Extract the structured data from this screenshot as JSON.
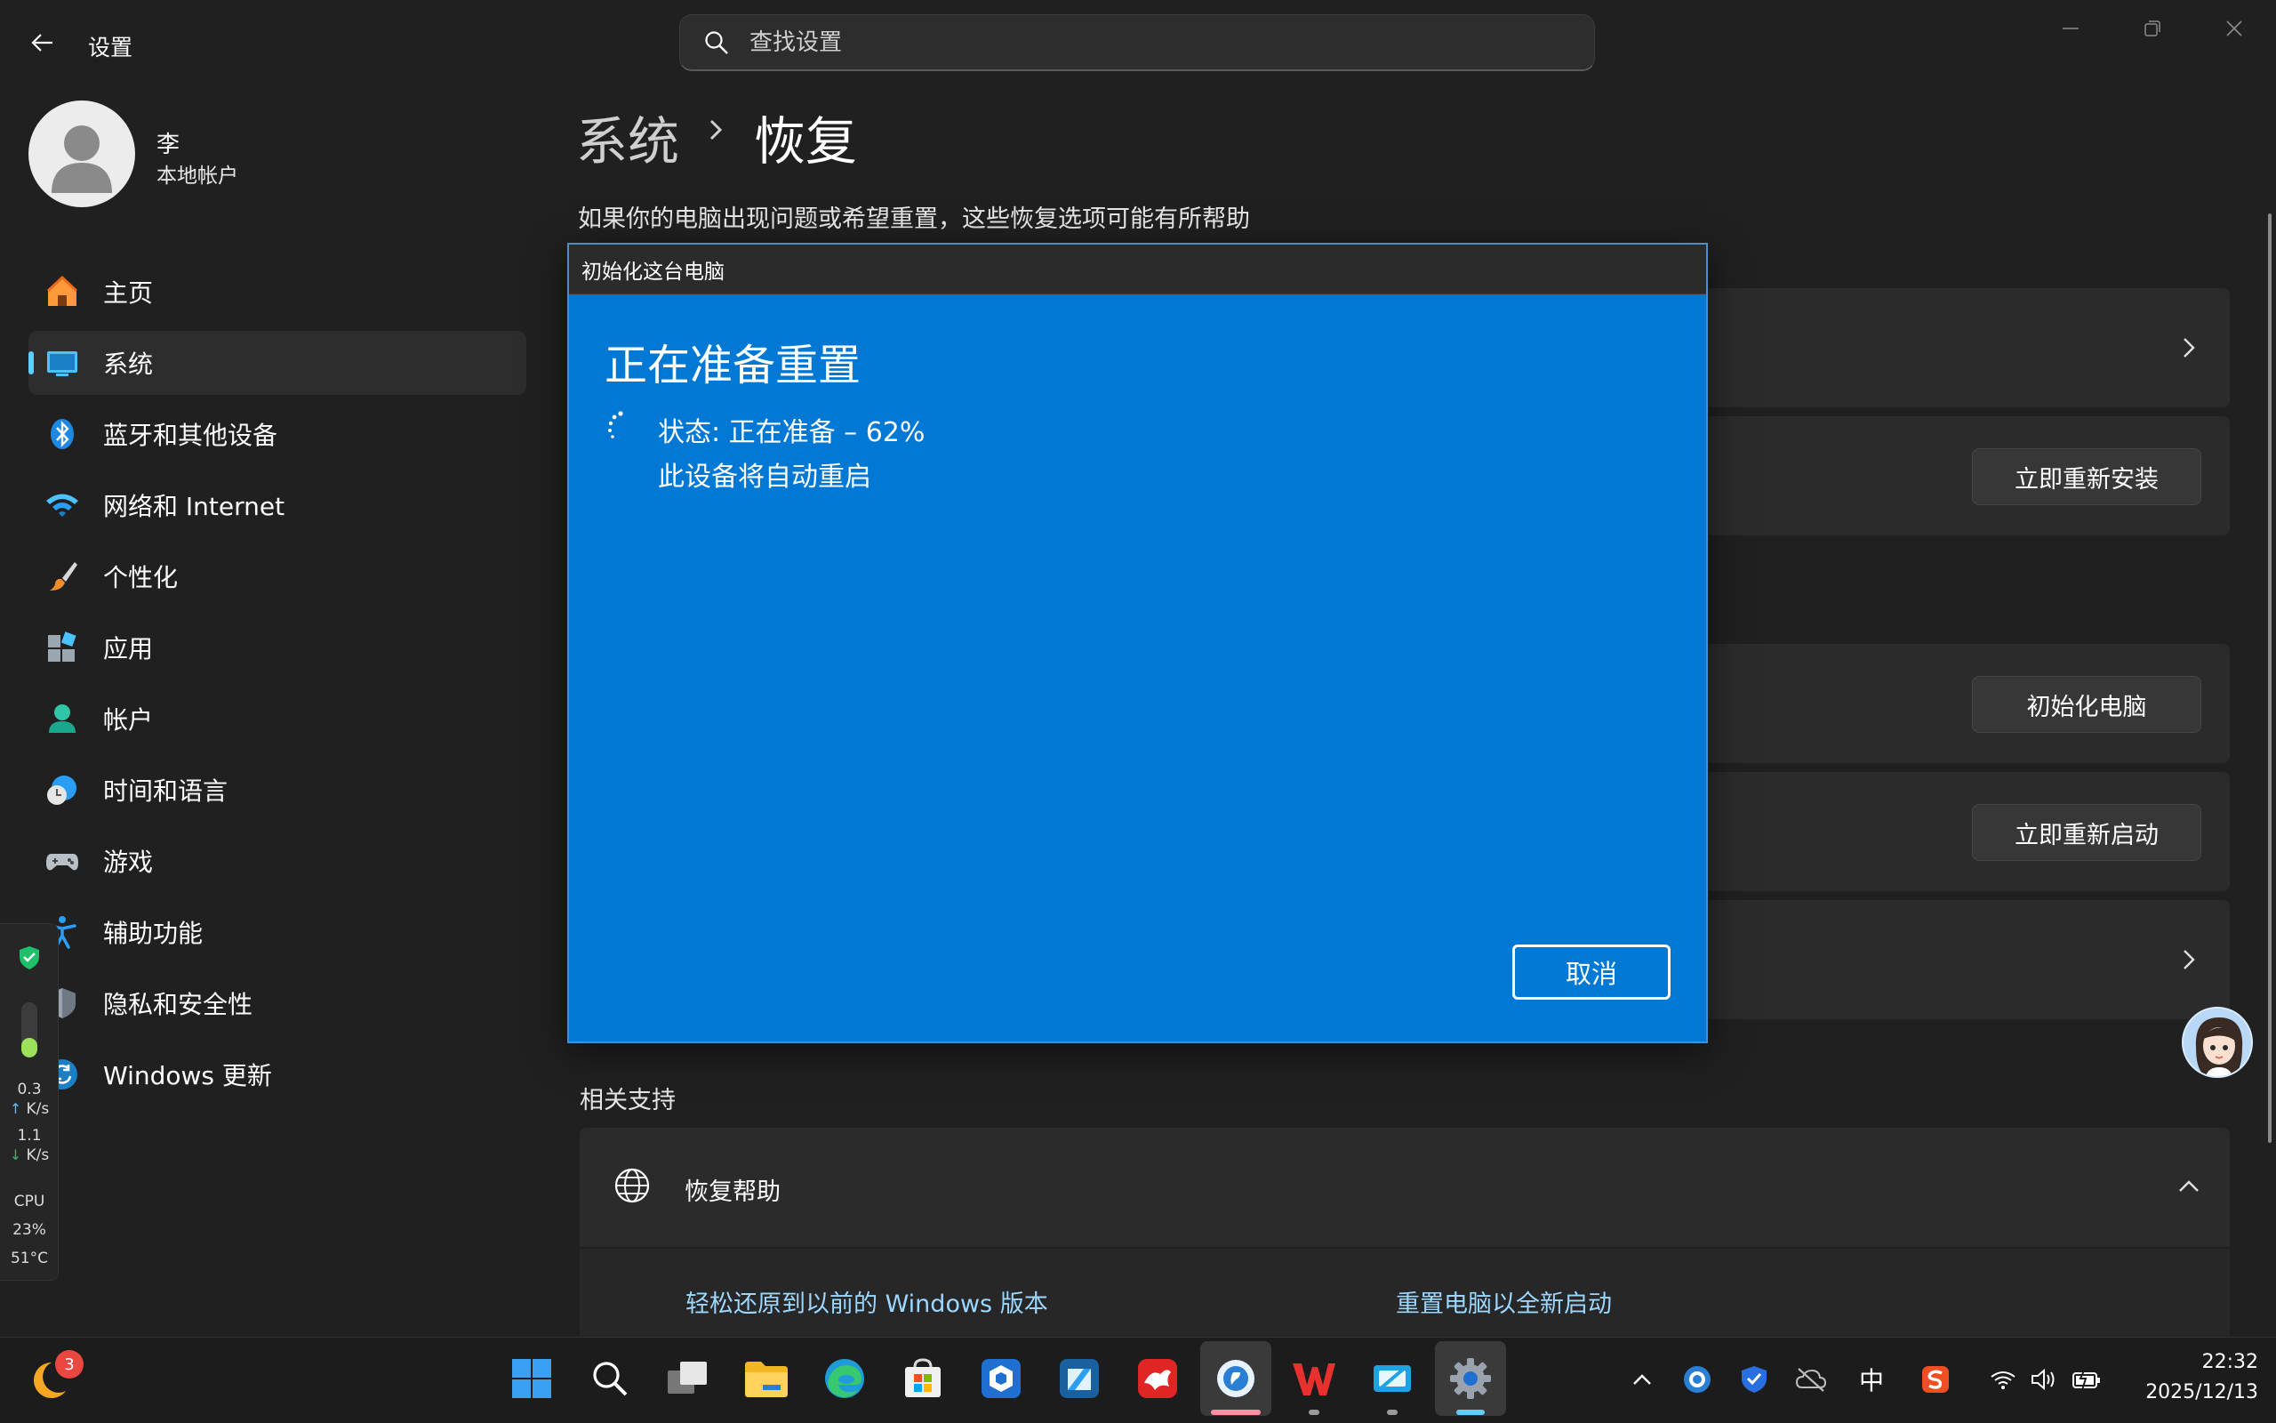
{
  "app": {
    "title": "设置",
    "search_placeholder": "查找设置"
  },
  "user": {
    "name": "李",
    "account_type": "本地帐户"
  },
  "nav": {
    "items": [
      {
        "label": "主页",
        "icon": "home-icon"
      },
      {
        "label": "系统",
        "icon": "system-display-icon",
        "active": true
      },
      {
        "label": "蓝牙和其他设备",
        "icon": "bluetooth-icon"
      },
      {
        "label": "网络和 Internet",
        "icon": "wifi-icon"
      },
      {
        "label": "个性化",
        "icon": "paintbrush-icon"
      },
      {
        "label": "应用",
        "icon": "apps-icon"
      },
      {
        "label": "帐户",
        "icon": "account-icon"
      },
      {
        "label": "时间和语言",
        "icon": "time-language-icon"
      },
      {
        "label": "游戏",
        "icon": "gamepad-icon"
      },
      {
        "label": "辅助功能",
        "icon": "accessibility-icon"
      },
      {
        "label": "隐私和安全性",
        "icon": "shield-icon"
      },
      {
        "label": "Windows 更新",
        "icon": "windows-update-icon"
      }
    ]
  },
  "monitor": {
    "upload_value": "0.3",
    "upload_unit": "K/s",
    "download_value": "1.1",
    "download_unit": "K/s",
    "cpu_label": "CPU",
    "cpu_usage": "23%",
    "cpu_temp": "51°C",
    "memory_fill": 0.35
  },
  "main": {
    "breadcrumb_parent": "系统",
    "breadcrumb_current": "恢复",
    "description": "如果你的电脑出现问题或希望重置，这些恢复选项可能有所帮助",
    "buttons": {
      "reinstall": "立即重新安装",
      "reset_pc": "初始化电脑",
      "restart_now": "立即重新启动"
    },
    "related_title": "相关支持",
    "help_title": "恢复帮助",
    "help_links": [
      "轻松还原到以前的 Windows 版本",
      "重置电脑以全新启动"
    ]
  },
  "dialog": {
    "title": "初始化这台电脑",
    "heading": "正在准备重置",
    "status": "状态: 正在准备 – 62%",
    "note": "此设备将自动重启",
    "cancel_label": "取消"
  },
  "taskbar": {
    "notification_count": "3",
    "ime_label": "中",
    "time": "22:32",
    "date": "2025/12/13"
  },
  "colors": {
    "accent": "#60cdff",
    "dialog_bg": "#0078d4",
    "window_bg": "#202020",
    "card_bg": "#2b2b2b"
  }
}
